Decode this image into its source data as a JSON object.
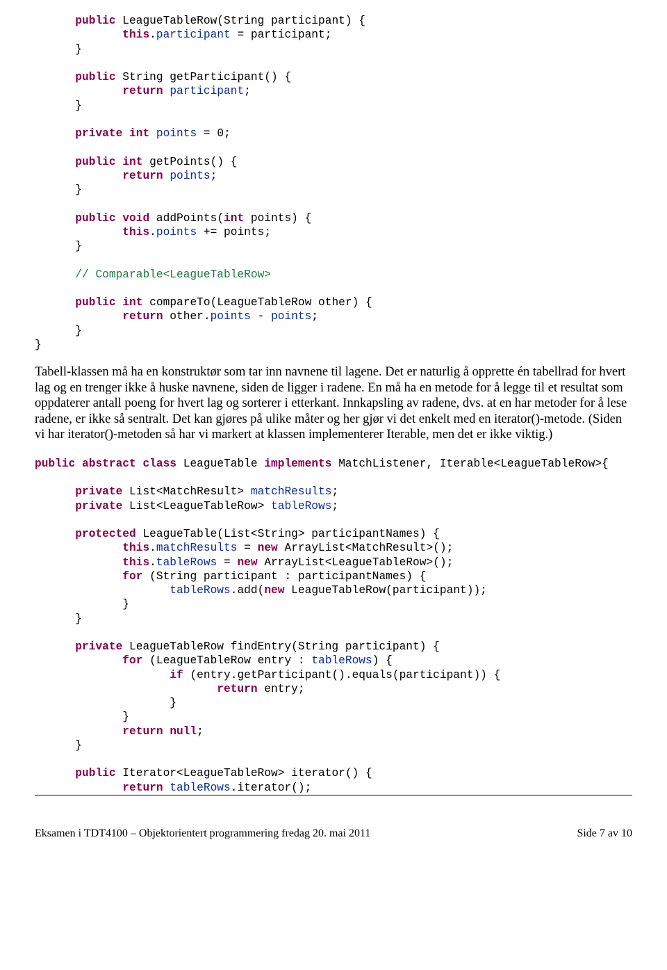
{
  "code1": {
    "l1a": "public",
    "l1b": " LeagueTableRow(String participant) {",
    "l2a": "this",
    "l2b": ".",
    "l2c": "participant",
    "l2d": " = participant;",
    "l3": "}",
    "l4a": "public",
    "l4b": " String getParticipant() {",
    "l5a": "return",
    "l5b": " ",
    "l5c": "participant",
    "l5d": ";",
    "l6": "}",
    "l7a": "private",
    "l7b": " ",
    "l7c": "int",
    "l7d": " ",
    "l7e": "points",
    "l7f": " = 0;",
    "l8a": "public",
    "l8b": " ",
    "l8c": "int",
    "l8d": " getPoints() {",
    "l9a": "return",
    "l9b": " ",
    "l9c": "points",
    "l9d": ";",
    "l10": "}",
    "l11a": "public",
    "l11b": " ",
    "l11c": "void",
    "l11d": " addPoints(",
    "l11e": "int",
    "l11f": " points) {",
    "l12a": "this",
    "l12b": ".",
    "l12c": "points",
    "l12d": " += points;",
    "l13": "}",
    "l14": "// Comparable<LeagueTableRow>",
    "l15a": "public",
    "l15b": " ",
    "l15c": "int",
    "l15d": " compareTo(LeagueTableRow other) {",
    "l16a": "return",
    "l16b": " other.",
    "l16c": "points",
    "l16d": " - ",
    "l16e": "points",
    "l16f": ";",
    "l17": "}",
    "l18": "}"
  },
  "para1": "Tabell-klassen må ha en konstruktør som tar inn navnene til lagene. Det er naturlig å opprette én tabellrad for hvert lag og en trenger ikke å huske navnene, siden de ligger i radene. En må ha en metode for å legge til et resultat som oppdaterer antall poeng for hvert lag og sorterer i etterkant. Innkapsling av radene, dvs. at en har metoder for å lese radene, er ikke så sentralt. Det kan gjøres på ulike måter og her gjør vi det enkelt med en iterator()-metode. (Siden vi har iterator()-metoden så har vi markert at klassen implementerer Iterable, men det er ikke viktig.)",
  "code2": {
    "h1a": "public",
    "h1b": " ",
    "h1c": "abstract",
    "h1d": " ",
    "h1e": "class",
    "h1f": " LeagueTable ",
    "h1g": "implements",
    "h1h": " MatchListener, Iterable<LeagueTableRow>{",
    "h2a": "private",
    "h2b": " List<MatchResult> ",
    "h2c": "matchResults",
    "h2d": ";",
    "h3a": "private",
    "h3b": " List<LeagueTableRow> ",
    "h3c": "tableRows",
    "h3d": ";",
    "h4a": "protected",
    "h4b": " LeagueTable(List<String> participantNames) {",
    "h5a": "this",
    "h5b": ".",
    "h5c": "matchResults",
    "h5d": " = ",
    "h5e": "new",
    "h5f": " ArrayList<MatchResult>();",
    "h6a": "this",
    "h6b": ".",
    "h6c": "tableRows",
    "h6d": " = ",
    "h6e": "new",
    "h6f": " ArrayList<LeagueTableRow>();",
    "h7a": "for",
    "h7b": " (String participant : participantNames) {",
    "h8a": "tableRows",
    "h8b": ".add(",
    "h8c": "new",
    "h8d": " LeagueTableRow(participant));",
    "h9": "}",
    "h10": "}",
    "h11a": "private",
    "h11b": " LeagueTableRow findEntry(String participant) {",
    "h12a": "for",
    "h12b": " (LeagueTableRow entry : ",
    "h12c": "tableRows",
    "h12d": ") {",
    "h13a": "if",
    "h13b": " (entry.getParticipant().equals(participant)) {",
    "h14a": "return",
    "h14b": " entry;",
    "h15": "}",
    "h16": "}",
    "h17a": "return",
    "h17b": " ",
    "h17c": "null",
    "h17d": ";",
    "h18": "}",
    "h19a": "public",
    "h19b": " Iterator<LeagueTableRow> iterator() {",
    "h20a": "return",
    "h20b": " ",
    "h20c": "tableRows",
    "h20d": ".iterator();"
  },
  "footer": {
    "left": "Eksamen i TDT4100 – Objektorientert programmering fredag 20. mai 2011",
    "right": "Side 7 av 10"
  }
}
